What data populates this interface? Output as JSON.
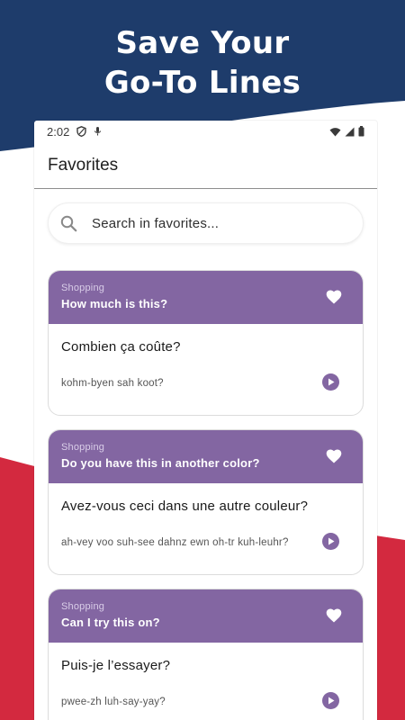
{
  "headline": {
    "line1": "Save Your",
    "line2": "Go-To Lines"
  },
  "colors": {
    "navy": "#1e3c6b",
    "red": "#d3293f",
    "accent": "#8366a2"
  },
  "status_bar": {
    "time": "2:02"
  },
  "app_bar": {
    "title": "Favorites"
  },
  "search": {
    "placeholder": "Search in favorites..."
  },
  "cards": [
    {
      "category": "Shopping",
      "question": "How much is this?",
      "translation": "Combien ça coûte?",
      "pronunciation": "kohm-byen sah koot?"
    },
    {
      "category": "Shopping",
      "question": "Do you have this in another color?",
      "translation": "Avez-vous ceci dans une autre couleur?",
      "pronunciation": "ah-vey voo suh-see dahnz ewn oh-tr kuh-leuhr?"
    },
    {
      "category": "Shopping",
      "question": "Can I try this on?",
      "translation": "Puis-je l’essayer?",
      "pronunciation": "pwee-zh luh-say-yay?"
    }
  ]
}
